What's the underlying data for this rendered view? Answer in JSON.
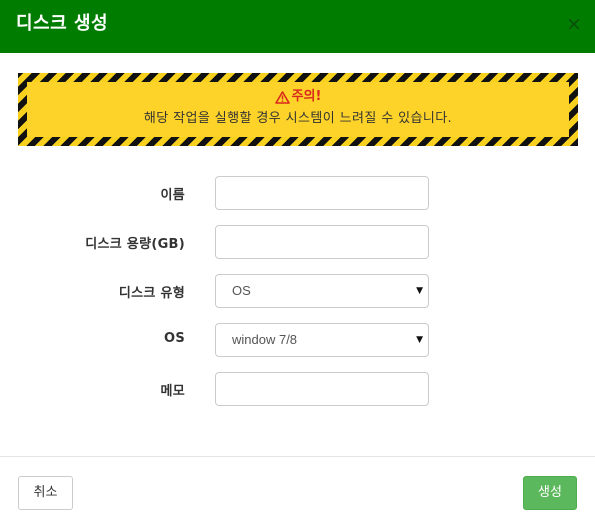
{
  "dialog": {
    "title": "디스크 생성",
    "close_symbol": "×",
    "close_icon": "close-icon"
  },
  "warning": {
    "icon": "warning-triangle-icon",
    "title": "주의!",
    "message": "해당 작업을 실행할 경우 시스템이 느려질 수 있습니다."
  },
  "form": {
    "name_label": "이름",
    "name_value": "",
    "capacity_label": "디스크 용량(GB)",
    "capacity_value": "",
    "type_label": "디스크 유형",
    "type_selected": "OS",
    "os_label": "OS",
    "os_selected": "window 7/8",
    "memo_label": "메모",
    "memo_value": "",
    "caret": "▼"
  },
  "footer": {
    "cancel_label": "취소",
    "create_label": "생성"
  },
  "colors": {
    "header_bg": "#007d00",
    "warning_bg": "#fdd32a",
    "warning_title": "#d9281c",
    "create_button": "#5cb85c"
  }
}
